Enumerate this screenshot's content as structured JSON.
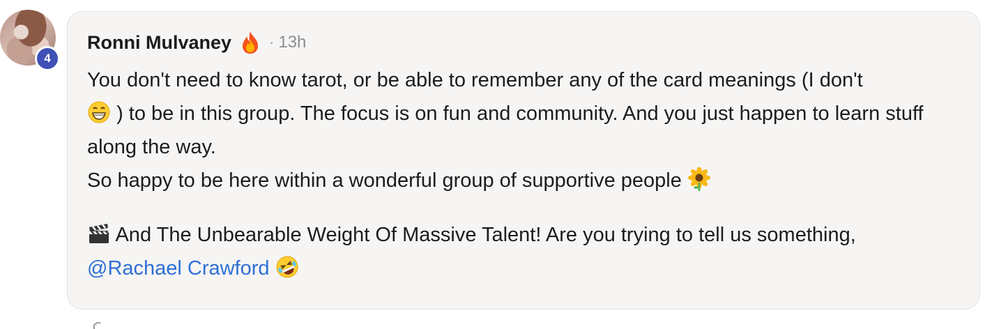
{
  "comment": {
    "avatar_level": "4",
    "author": "Ronni Mulvaney",
    "meta_separator": "·",
    "time": "13h",
    "line1_a": "You don't need to know tarot, or be able to remember any of the card meanings (I don't",
    "line1_b": ") to be in this group. The focus is on fun and community. And you just happen to learn stuff along the way.",
    "line2": "So happy to be here within a wonderful group of supportive people",
    "line3": "And The Unbearable Weight Of Massive Talent! Are you trying to tell us something,",
    "mention": "@Rachael Crawford"
  },
  "icons": {
    "author_badge": "fire-emoji-icon",
    "e1": "grinning-face-emoji-icon",
    "e2": "sunflower-emoji-icon",
    "e3": "clapper-board-emoji-icon",
    "e4": "rolling-on-floor-laughing-emoji-icon"
  },
  "colors": {
    "bubble_bg": "#f6f5f4",
    "mention": "#2f6fd6",
    "level_badge": "#3f51b5"
  }
}
